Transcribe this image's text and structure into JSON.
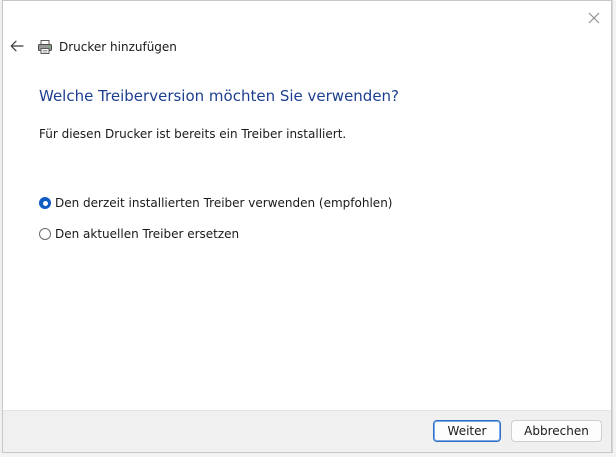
{
  "window": {
    "title": "Drucker hinzufügen",
    "close_icon": "close-icon",
    "back_icon": "back-arrow-icon",
    "printer_icon": "printer-icon"
  },
  "content": {
    "heading": "Welche Treiberversion möchten Sie verwenden?",
    "intro": "Für diesen Drucker ist bereits ein Treiber installiert.",
    "options": [
      {
        "label": "Den derzeit installierten Treiber verwenden (empfohlen)",
        "checked": true
      },
      {
        "label": "Den aktuellen Treiber ersetzen",
        "checked": false
      }
    ]
  },
  "footer": {
    "next_label": "Weiter",
    "cancel_label": "Abbrechen"
  },
  "colors": {
    "heading": "#1d3f8f",
    "accent": "#0f5cc4",
    "footer_bg": "#f0f0f0"
  }
}
